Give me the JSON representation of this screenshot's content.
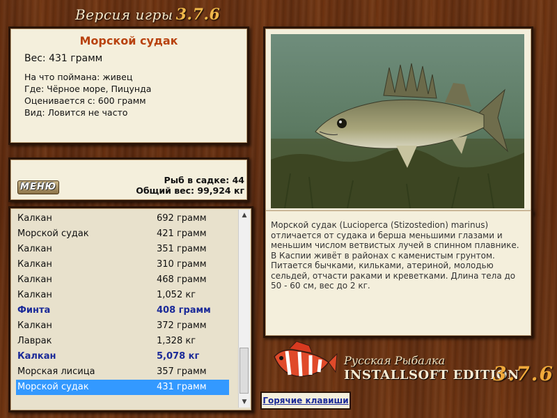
{
  "header": {
    "version_label": "Версия игры",
    "version_number": "3.7.6"
  },
  "fish_info": {
    "title": "Морской судак",
    "weight": "Вес: 431 грамм",
    "caught_on": "На что поймана: живец",
    "location": "Где: Чёрное море, Пицунда",
    "valued_from": "Оценивается с: 600 грамм",
    "rarity": "Вид: Ловится не часто"
  },
  "summary": {
    "menu_label": "МЕНЮ",
    "fish_count": "Рыб в садке: 44",
    "total_weight": "Общий вес: 99,924 кг"
  },
  "catch_list": [
    {
      "name": "Калкан",
      "weight": "692 грамм",
      "style": "normal"
    },
    {
      "name": "Морской судак",
      "weight": "421 грамм",
      "style": "normal"
    },
    {
      "name": "Калкан",
      "weight": "351 грамм",
      "style": "normal"
    },
    {
      "name": "Калкан",
      "weight": "310 грамм",
      "style": "normal"
    },
    {
      "name": "Калкан",
      "weight": "468 грамм",
      "style": "normal"
    },
    {
      "name": "Калкан",
      "weight": "1,052 кг",
      "style": "normal"
    },
    {
      "name": "Финта",
      "weight": "408 грамм",
      "style": "highlight"
    },
    {
      "name": "Калкан",
      "weight": "372 грамм",
      "style": "normal"
    },
    {
      "name": "Лаврак",
      "weight": "1,328 кг",
      "style": "normal"
    },
    {
      "name": "Калкан",
      "weight": "5,078 кг",
      "style": "highlight"
    },
    {
      "name": "Морская лисица",
      "weight": "357 грамм",
      "style": "normal"
    },
    {
      "name": "Морской судак",
      "weight": "431 грамм",
      "style": "selected"
    }
  ],
  "description": "Морской судак (Lucioperca (Stizostedion) marinus) отличается от судака и берша меньшими глазами и меньшим числом ветвистых лучей в спинном плавнике. В Каспии живёт в районах с каменистым грунтом. Питается бычками, кильками, атериной, молодью сельдей, отчасти раками и креветками. Длина тела до 50 - 60 см, вес до 2 кг.",
  "logo": {
    "line1": "Русская Рыбалка",
    "line2": "INSTALLSOFT EDITION",
    "version": "3.7.6"
  },
  "hotkeys_label": "Горячие клавиши",
  "colors": {
    "selected_row": "#3399ff",
    "highlight_text": "#1b2a98",
    "title": "#b8420f"
  }
}
